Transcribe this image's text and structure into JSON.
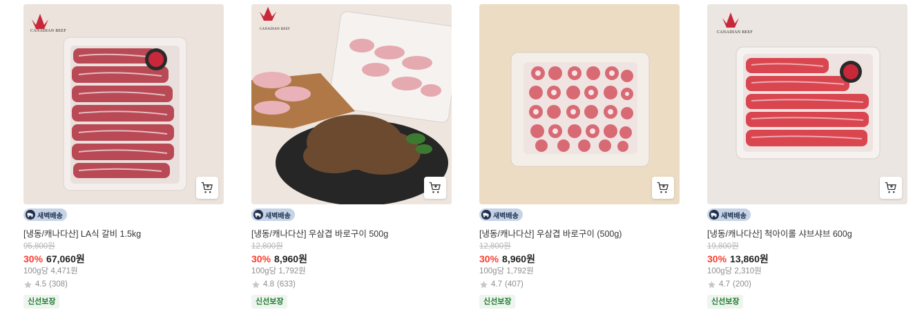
{
  "delivery_badge_label": "새벽배송",
  "fresh_badge_label": "신선보장",
  "products": [
    {
      "name": "[냉동/캐나다산] LA식 갈비 1.5kg",
      "original_price": "95,800원",
      "discount": "30%",
      "price": "67,060원",
      "unit_price": "100g당 4,471원",
      "rating": "4.5",
      "review_count": "(308)",
      "logo_text": "CANADIAN BEEF"
    },
    {
      "name": "[냉동/캐나다산] 우삼겹 바로구이 500g",
      "original_price": "12,800원",
      "discount": "30%",
      "price": "8,960원",
      "unit_price": "100g당 1,792원",
      "rating": "4.8",
      "review_count": "(633)",
      "logo_text": "CANADIAN BEEF"
    },
    {
      "name": "[냉동/캐나다산] 우삼겹 바로구이 (500g)",
      "original_price": "12,800원",
      "discount": "30%",
      "price": "8,960원",
      "unit_price": "100g당 1,792원",
      "rating": "4.7",
      "review_count": "(407)"
    },
    {
      "name": "[냉동/캐나다산] 척아이롤 샤브샤브 600g",
      "original_price": "19,800원",
      "discount": "30%",
      "price": "13,860원",
      "unit_price": "100g당 2,310원",
      "rating": "4.7",
      "review_count": "(200)",
      "logo_text": "CANADIAN BEEF"
    }
  ],
  "colors": {
    "discount": "#fa3c2d",
    "badge_bg": "#c5d3e6",
    "fresh_text": "#1c7a2f",
    "star": "#c7c7c7"
  }
}
